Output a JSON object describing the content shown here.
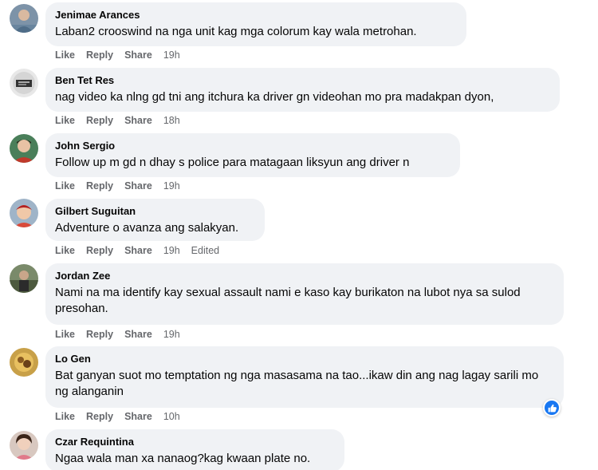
{
  "labels": {
    "like": "Like",
    "reply": "Reply",
    "share": "Share"
  },
  "comments": [
    {
      "author": "Jenimae Arances",
      "text": "Laban2 crooswind na nga unit kag mga colorum kay wala metrohan.",
      "time": "19h"
    },
    {
      "author": "Ben Tet Res",
      "text": "nag video ka nlng gd tni ang itchura ka driver gn videohan mo pra madakpan dyon,",
      "time": "18h"
    },
    {
      "author": "John Sergio",
      "text": "Follow up m gd n dhay s police para matagaan liksyun ang driver n",
      "time": "19h"
    },
    {
      "author": "Gilbert Suguitan",
      "text": "Adventure o avanza ang salakyan.",
      "time": "19h",
      "edited": "Edited"
    },
    {
      "author": "Jordan Zee",
      "text": "Nami na ma identify kay sexual assault nami e kaso kay burikaton na lubot nya sa sulod presohan.",
      "time": "19h"
    },
    {
      "author": "Lo Gen",
      "text": "Bat ganyan suot mo temptation ng nga masasama na tao...ikaw din ang nag lagay sarili mo ng alanganin",
      "time": "10h",
      "reaction": "like-reaction-icon"
    },
    {
      "author": "Czar Requintina",
      "text": "Ngaa wala man xa nanaog?kag kwaan plate no."
    }
  ],
  "colors": {
    "bubble": "#f0f2f5",
    "meta": "#65676b",
    "like_blue": "#1877f2"
  }
}
